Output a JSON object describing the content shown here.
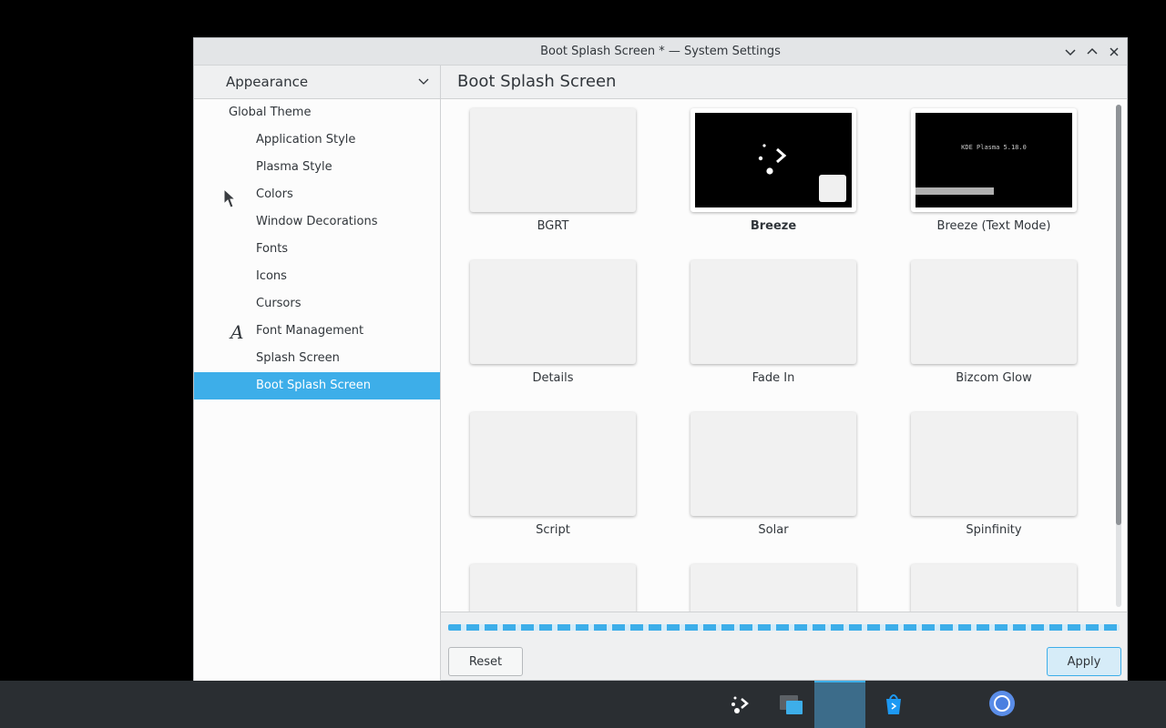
{
  "window": {
    "title": "Boot Splash Screen * — System Settings"
  },
  "sidebar": {
    "header": "Appearance",
    "items": [
      {
        "label": "Global Theme",
        "level": "top",
        "active": false
      },
      {
        "label": "Application Style",
        "level": "child",
        "active": false
      },
      {
        "label": "Plasma Style",
        "level": "child",
        "active": false
      },
      {
        "label": "Colors",
        "level": "child",
        "active": false
      },
      {
        "label": "Window Decorations",
        "level": "child",
        "active": false
      },
      {
        "label": "Fonts",
        "level": "child",
        "active": false
      },
      {
        "label": "Icons",
        "level": "child",
        "active": false
      },
      {
        "label": "Cursors",
        "level": "child",
        "active": false
      },
      {
        "label": "Font Management",
        "level": "child",
        "active": false,
        "icon": "A"
      },
      {
        "label": "Splash Screen",
        "level": "child",
        "active": false
      },
      {
        "label": "Boot Splash Screen",
        "level": "child",
        "active": true
      }
    ]
  },
  "content": {
    "title": "Boot Splash Screen",
    "themes": [
      {
        "label": "BGRT",
        "preview": "blank",
        "selected": false
      },
      {
        "label": "Breeze",
        "preview": "breeze",
        "selected": true
      },
      {
        "label": "Breeze (Text Mode)",
        "preview": "text",
        "preview_text": "KDE Plasma 5.18.0",
        "selected": false
      },
      {
        "label": "Details",
        "preview": "blank",
        "selected": false
      },
      {
        "label": "Fade In",
        "preview": "blank",
        "selected": false
      },
      {
        "label": "Bizcom Glow",
        "preview": "blank",
        "selected": false
      },
      {
        "label": "Script",
        "preview": "blank",
        "selected": false
      },
      {
        "label": "Solar",
        "preview": "blank",
        "selected": false
      },
      {
        "label": "Spinfinity",
        "preview": "blank",
        "selected": false
      },
      {
        "label": "",
        "preview": "blank",
        "selected": false
      },
      {
        "label": "",
        "preview": "blank",
        "selected": false
      },
      {
        "label": "",
        "preview": "blank",
        "selected": false
      }
    ],
    "progress_fraction": 1.0
  },
  "buttons": {
    "reset": "Reset",
    "apply": "Apply"
  },
  "taskbar": {
    "items": [
      {
        "icon": "plasma-launcher-icon",
        "active": false
      },
      {
        "icon": "file-manager-icon",
        "active": false
      },
      {
        "icon": "system-settings-icon",
        "active": true
      },
      {
        "icon": "discover-store-icon",
        "active": false
      },
      {
        "icon": "chromium-browser-icon",
        "active": false
      }
    ]
  },
  "colors": {
    "accent": "#3daee9",
    "window_bg": "#eff0f1",
    "taskbar_bg": "#2a2e32"
  }
}
